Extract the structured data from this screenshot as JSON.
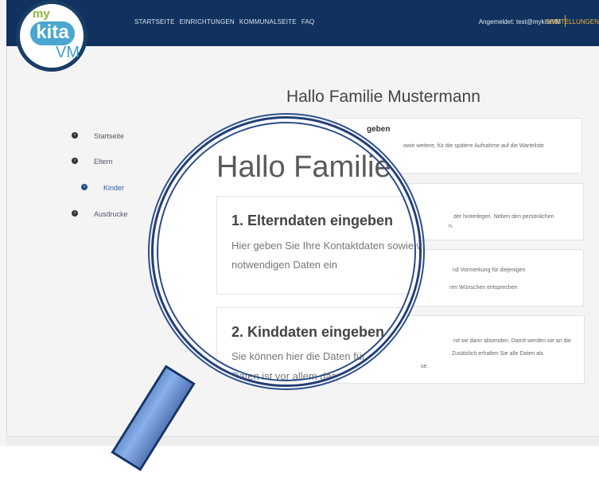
{
  "header": {
    "nav": [
      "STARTSEITE",
      "EINRICHTUNGEN",
      "KOMMUNALSEITE",
      "FAQ"
    ],
    "login": "Angemeldet: test@mykitaVM",
    "settings": "EINSTELLUNGEN"
  },
  "logo": {
    "my": "my",
    "kita": "kita",
    "vm": "VM"
  },
  "main": {
    "greeting": "Hallo Familie Mustermann"
  },
  "sidebar": {
    "items": [
      {
        "label": "Startseite"
      },
      {
        "label": "Eltern"
      },
      {
        "label": "Kinder"
      },
      {
        "label": "Ausdrucke"
      }
    ]
  },
  "cards": [
    {
      "title": "geben",
      "line1": "owie weitere, für die spätere Aufnahme auf die Warteliste"
    },
    {
      "line1": "der hinterlegen. Neben den persönlichen",
      "line2": "n."
    },
    {
      "line1": "nd Vormerkung für diejenigen",
      "line2": "ren Wünschen entsprechen"
    },
    {
      "line1": "nd sie dann absenden. Damit werden sie an die",
      "line2": ". Zusätzlich erhalten Sie alle Daten als",
      "line3": "se."
    }
  ],
  "zoom": {
    "greeting": "Hallo Familie M",
    "card1_title": "1. Elterndaten eingeben",
    "card1_line1": "Hier geben Sie Ihre Kontaktdaten sowie we",
    "card1_line2": "notwendigen Daten ein",
    "card2_title": "2. Kinddaten eingeben",
    "card2_line1": "Sie können hier die Daten für ein ode",
    "card2_line2": "Daten ist vor allem das gewünsch"
  },
  "colors": {
    "header": "#11325e",
    "accent": "#f0b238",
    "sidebar_active": "#2d5f9f",
    "magnifier": "#243f79"
  }
}
